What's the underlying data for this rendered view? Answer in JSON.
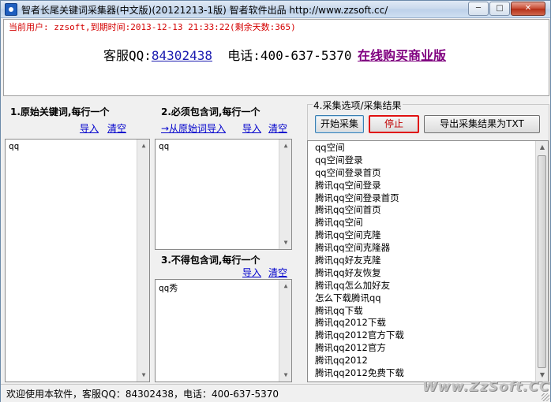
{
  "window": {
    "title": "智者长尾关键词采集器(中文版)(20121213-1版) 智者软件出品 http://www.zzsoft.cc/",
    "min_glyph": "─",
    "max_glyph": "□",
    "close_glyph": "✕"
  },
  "header": {
    "user_info": "当前用户: zzsoft,到期时间:2013-12-13 21:33:22(剩余天数:365)",
    "qq_label": "客服QQ:",
    "qq_number": "84302438",
    "phone": "电话:400-637-5370",
    "buy_link": "在线购买商业版"
  },
  "section1": {
    "title": "1.原始关键词,每行一个",
    "import_label": "导入",
    "clear_label": "清空",
    "content": "qq"
  },
  "section2": {
    "title": "2.必须包含词,每行一个",
    "import_from_label": "→从原始词导入",
    "import_label": "导入",
    "clear_label": "清空",
    "content": "qq"
  },
  "section3": {
    "title": "3.不得包含词,每行一个",
    "import_label": "导入",
    "clear_label": "清空",
    "content": "qq秀"
  },
  "section4": {
    "title": "4.采集选项/采集结果",
    "start_button": "开始采集",
    "stop_button": "停止",
    "export_button": "导出采集结果为TXT",
    "results": [
      "qq空间",
      "qq空间登录",
      "qq空间登录首页",
      "腾讯qq空间登录",
      "腾讯qq空间登录首页",
      "腾讯qq空间首页",
      "腾讯qq空间",
      "腾讯qq空间克隆",
      "腾讯qq空间克隆器",
      "腾讯qq好友克隆",
      "腾讯qq好友恢复",
      "腾讯qq怎么加好友",
      "怎么下载腾讯qq",
      "腾讯qq下载",
      "腾讯qq2012下载",
      "腾讯qq2012官方下载",
      "腾讯qq2012官方",
      "腾讯qq2012",
      "腾讯qq2012免费下载"
    ]
  },
  "statusbar": {
    "text": "欢迎使用本软件，客服QQ：84302438，电话：400-637-5370",
    "watermark": "Www.ZzSoft.CC"
  },
  "scroll_glyphs": {
    "up": "▲",
    "down": "▼"
  }
}
